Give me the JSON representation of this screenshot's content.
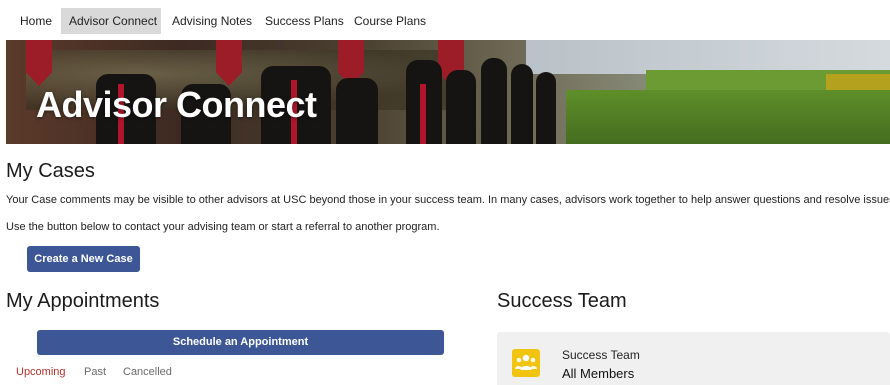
{
  "nav": {
    "items": [
      {
        "label": "Home",
        "active": false
      },
      {
        "label": "Advisor Connect",
        "active": true
      },
      {
        "label": "Advising Notes",
        "active": false
      },
      {
        "label": "Success Plans",
        "active": false
      },
      {
        "label": "Course Plans",
        "active": false
      }
    ]
  },
  "hero": {
    "title": "Advisor Connect"
  },
  "cases": {
    "heading": "My Cases",
    "description": "Your Case comments may be visible to other advisors at USC beyond those in your success team. In many cases, advisors work together to help answer questions and resolve issues.",
    "instruction": "Use the button below to contact your advising team or start a referral to another program.",
    "create_button": "Create a New Case"
  },
  "appointments": {
    "heading": "My Appointments",
    "schedule_button": "Schedule an Appointment",
    "tabs": [
      {
        "label": "Upcoming",
        "active": true
      },
      {
        "label": "Past",
        "active": false
      },
      {
        "label": "Cancelled",
        "active": false
      }
    ]
  },
  "success_team": {
    "heading": "Success Team",
    "card_title": "Success Team",
    "card_subtitle": "All Members",
    "icon": "team-icon",
    "icon_color": "#f1c40f"
  },
  "colors": {
    "primary_button": "#3d5796",
    "active_tab": "#b0332f",
    "nav_active_bg": "#d9d9d9"
  }
}
